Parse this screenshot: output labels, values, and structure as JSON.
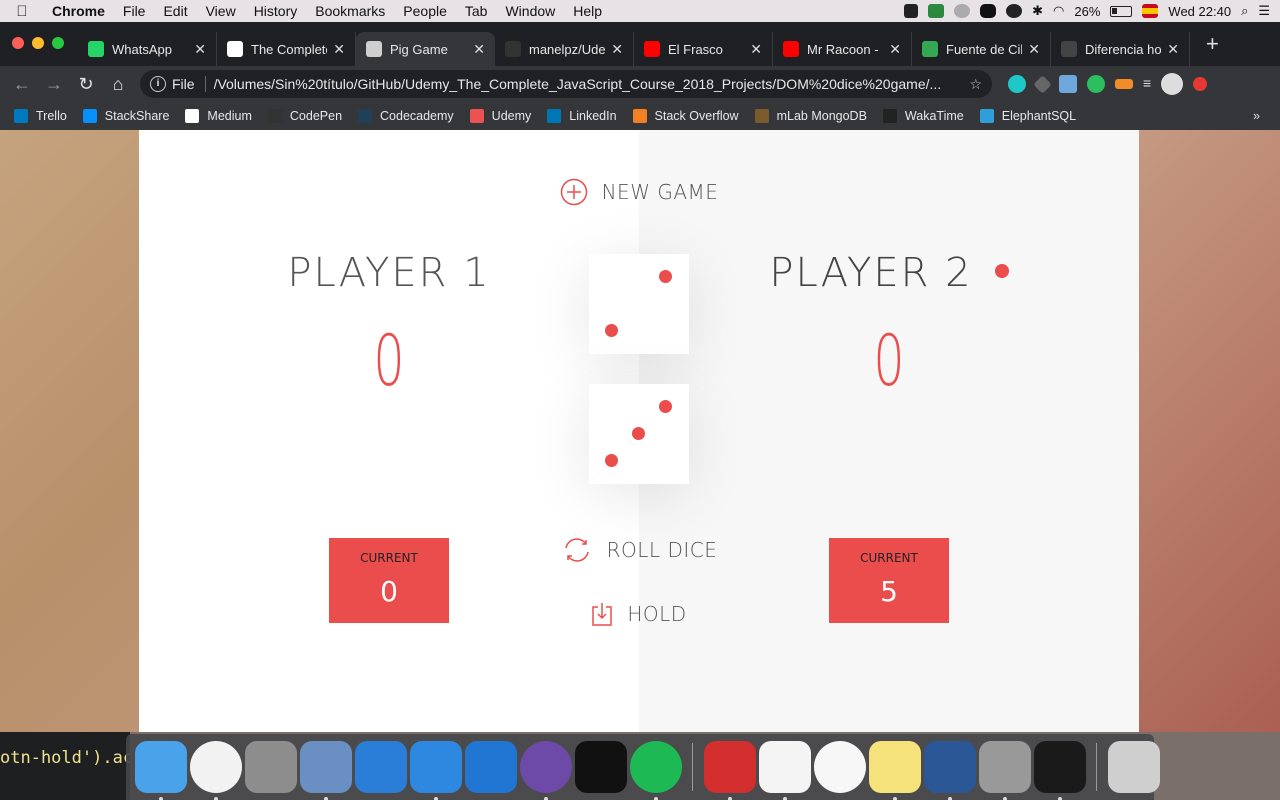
{
  "menubar": {
    "app": "Chrome",
    "items": [
      "File",
      "Edit",
      "View",
      "History",
      "Bookmarks",
      "People",
      "Tab",
      "Window",
      "Help"
    ],
    "battery": "26%",
    "clock": "Wed 22:40"
  },
  "tabs": [
    {
      "title": "WhatsApp",
      "icon": "whatsapp-icon",
      "color": "#25d366",
      "active": false
    },
    {
      "title": "The Complete",
      "icon": "citi-icon",
      "color": "#ffffff",
      "active": false
    },
    {
      "title": "Pig Game",
      "icon": "globe-icon",
      "color": "#cfcfcf",
      "active": true
    },
    {
      "title": "manelpz/Ude",
      "icon": "github-icon",
      "color": "#333333",
      "active": false
    },
    {
      "title": "El Frasco",
      "icon": "youtube-icon",
      "color": "#ff0000",
      "active": false
    },
    {
      "title": "Mr Racoon -",
      "icon": "youtube-icon",
      "color": "#ff0000",
      "active": false
    },
    {
      "title": "Fuente de Cil",
      "icon": "maps-icon",
      "color": "#34a853",
      "active": false
    },
    {
      "title": "Diferencia ho",
      "icon": "clock-icon",
      "color": "#444444",
      "active": false
    }
  ],
  "address": {
    "scheme": "File",
    "url": "/Volumes/Sin%20título/GitHub/Udemy_The_Complete_JavaScript_Course_2018_Projects/DOM%20dice%20game/..."
  },
  "bookmarks": [
    {
      "label": "Trello",
      "color": "#0079bf"
    },
    {
      "label": "StackShare",
      "color": "#0690fa"
    },
    {
      "label": "Medium",
      "color": "#ffffff"
    },
    {
      "label": "CodePen",
      "color": "#333333"
    },
    {
      "label": "Codecademy",
      "color": "#1f4056"
    },
    {
      "label": "Udemy",
      "color": "#ec5252"
    },
    {
      "label": "LinkedIn",
      "color": "#0077b5"
    },
    {
      "label": "Stack Overflow",
      "color": "#f48024"
    },
    {
      "label": "mLab MongoDB",
      "color": "#7b5b2c"
    },
    {
      "label": "WakaTime",
      "color": "#222222"
    },
    {
      "label": "ElephantSQL",
      "color": "#2e9fd9"
    }
  ],
  "game": {
    "new_game_label": "NEW GAME",
    "roll_dice_label": "ROLL DICE",
    "hold_label": "HOLD",
    "accent_color": "#eb4d4d",
    "player1": {
      "name": "PLAYER 1",
      "score": "0",
      "current_label": "CURRENT",
      "current": "0",
      "active": false
    },
    "player2": {
      "name": "PLAYER 2",
      "score": "0",
      "current_label": "CURRENT",
      "current": "5",
      "active": true
    },
    "dice": [
      2,
      3
    ]
  },
  "editor_peek": "otn-hold').ac",
  "dock": [
    "finder",
    "chrome",
    "launchpad",
    "preview",
    "xcode",
    "simulator",
    "vscode",
    "github-desktop",
    "hyper",
    "spotify",
    "acrobat",
    "textedit",
    "itunes",
    "notes",
    "word",
    "calculator",
    "terminal",
    "trash"
  ]
}
